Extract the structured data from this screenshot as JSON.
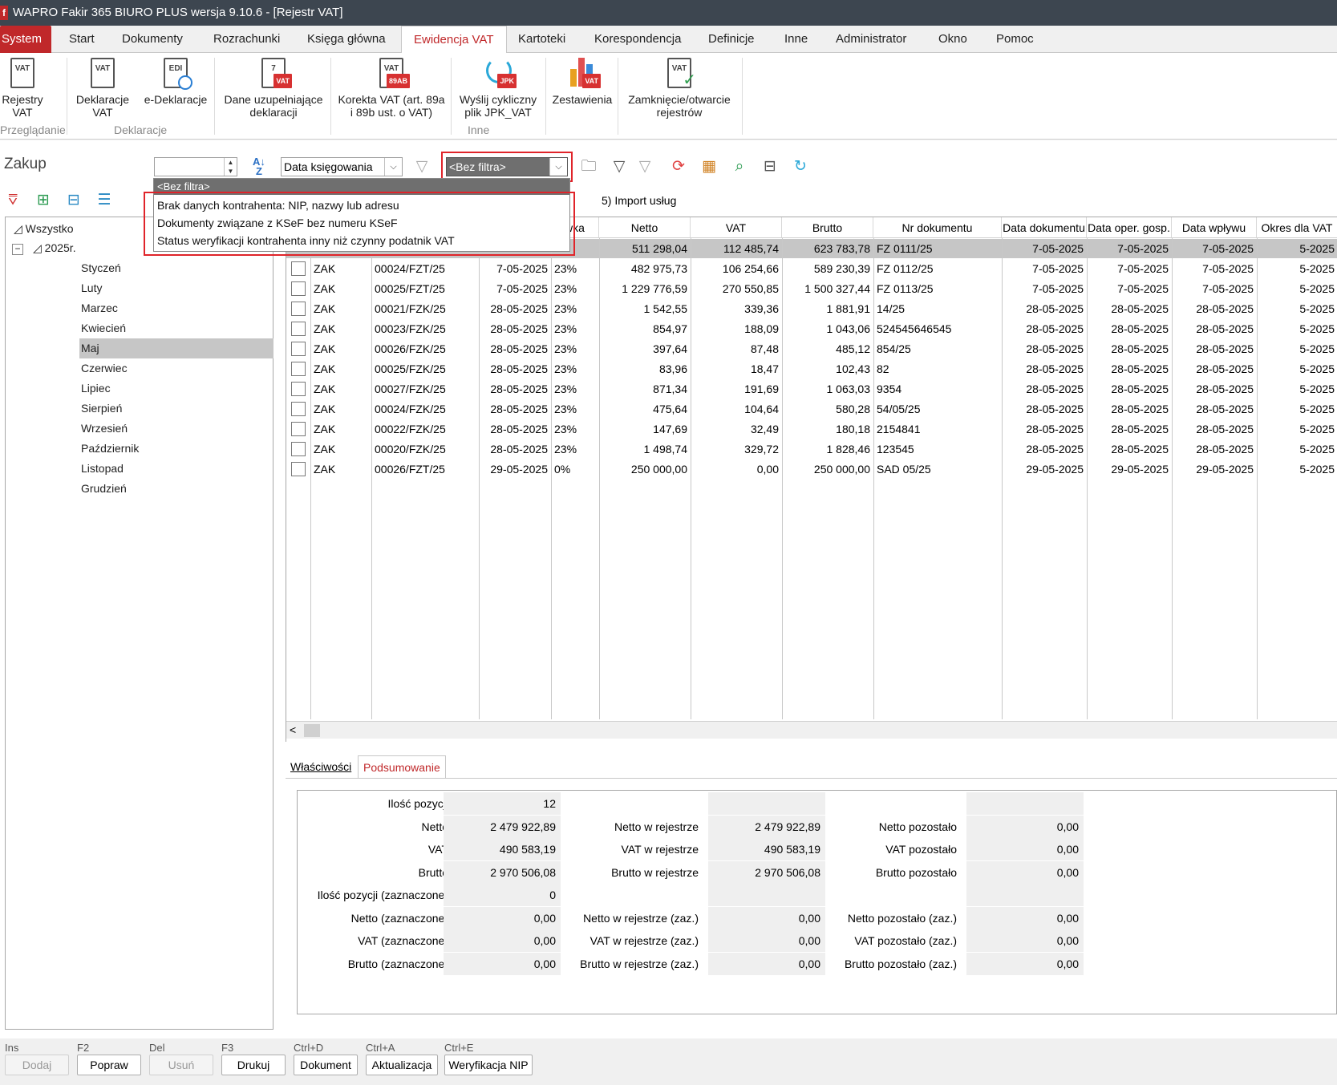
{
  "window": {
    "title": "WAPRO Fakir 365 BIURO PLUS wersja 9.10.6 - [Rejestr VAT]",
    "app_letter": "f"
  },
  "menu": [
    "System",
    "Start",
    "Dokumenty",
    "Rozrachunki",
    "Księga główna",
    "Ewidencja VAT",
    "Kartoteki",
    "Korespondencja",
    "Definicje",
    "Inne",
    "Administrator",
    "Okno",
    "Pomoc"
  ],
  "ribbon": {
    "buttons": [
      {
        "label1": "Rejestry",
        "label2": "VAT",
        "icon": "vat-register-icon",
        "tag": "",
        "doc": "VAT"
      },
      {
        "label1": "Deklaracje",
        "label2": "VAT",
        "icon": "vat-declaration-icon",
        "tag": "",
        "doc": "VAT"
      },
      {
        "label1": "e-Deklaracje",
        "label2": "",
        "icon": "e-declaration-icon",
        "tag": "",
        "doc": "EDI"
      },
      {
        "label1": "Dane uzupełniające",
        "label2": "deklaracji",
        "icon": "supplementary-data-icon",
        "tag": "VAT",
        "doc": "7"
      },
      {
        "label1": "Korekta VAT (art. 89a",
        "label2": "i 89b ust. o VAT)",
        "icon": "vat-correction-icon",
        "tag": "89AB",
        "doc": "VAT"
      },
      {
        "label1": "Wyślij cykliczny",
        "label2": "plik JPK_VAT",
        "icon": "jpk-send-icon",
        "tag": "JPK",
        "doc": ""
      },
      {
        "label1": "Zestawienia",
        "label2": "",
        "icon": "reports-chart-icon",
        "tag": "VAT",
        "doc": ""
      },
      {
        "label1": "Zamknięcie/otwarcie",
        "label2": "rejestrów",
        "icon": "close-registers-icon",
        "tag": "",
        "doc": "VAT"
      }
    ],
    "groups": [
      "Przeglądanie",
      "Deklaracje",
      "Inne"
    ]
  },
  "toolbar": {
    "section_title": "Zakup",
    "sort_field": "Data księgowania",
    "filter_value": "<Bez filtra>",
    "import_label": "5) Import usług"
  },
  "dropdown": {
    "selected": "<Bez filtra>",
    "options": [
      "Brak danych kontrahenta: NIP, nazwy lub adresu",
      "Dokumenty związane z KSeF bez numeru KSeF",
      "Status weryfikacji kontrahenta inny niż czynny podatnik VAT"
    ]
  },
  "tree": {
    "all": "Wszystko",
    "year": "2025r.",
    "months": [
      "Styczeń",
      "Luty",
      "Marzec",
      "Kwiecień",
      "Maj",
      "Czerwiec",
      "Lipiec",
      "Sierpień",
      "Wrzesień",
      "Październik",
      "Listopad",
      "Grudzień"
    ],
    "selected": "Maj"
  },
  "grid": {
    "columns": [
      "",
      "",
      "",
      "",
      "Stawka",
      "Netto",
      "VAT",
      "Brutto",
      "Nr dokumentu",
      "Data dokumentu",
      "Data oper. gosp.",
      "Data wpływu",
      "Okres dla VAT"
    ],
    "visible_header": [
      "wka",
      "Netto",
      "VAT",
      "Brutto",
      "Nr dokumentu",
      "Data dokumentu",
      "Data oper. gosp.",
      "Data wpływu",
      "Okres dla VAT"
    ],
    "rows": [
      {
        "typ": "",
        "nr": "",
        "data": "",
        "stawka": "",
        "netto": "511 298,04",
        "vat": "112 485,74",
        "brutto": "623 783,78",
        "nrdok": "FZ 0111/25",
        "ddok": "7-05-2025",
        "doper": "7-05-2025",
        "dwpl": "7-05-2025",
        "okres": "5-2025"
      },
      {
        "typ": "ZAK",
        "nr": "00024/FZT/25",
        "data": "7-05-2025",
        "stawka": "23%",
        "netto": "482 975,73",
        "vat": "106 254,66",
        "brutto": "589 230,39",
        "nrdok": "FZ 0112/25",
        "ddok": "7-05-2025",
        "doper": "7-05-2025",
        "dwpl": "7-05-2025",
        "okres": "5-2025"
      },
      {
        "typ": "ZAK",
        "nr": "00025/FZT/25",
        "data": "7-05-2025",
        "stawka": "23%",
        "netto": "1 229 776,59",
        "vat": "270 550,85",
        "brutto": "1 500 327,44",
        "nrdok": "FZ 0113/25",
        "ddok": "7-05-2025",
        "doper": "7-05-2025",
        "dwpl": "7-05-2025",
        "okres": "5-2025"
      },
      {
        "typ": "ZAK",
        "nr": "00021/FZK/25",
        "data": "28-05-2025",
        "stawka": "23%",
        "netto": "1 542,55",
        "vat": "339,36",
        "brutto": "1 881,91",
        "nrdok": "14/25",
        "ddok": "28-05-2025",
        "doper": "28-05-2025",
        "dwpl": "28-05-2025",
        "okres": "5-2025"
      },
      {
        "typ": "ZAK",
        "nr": "00023/FZK/25",
        "data": "28-05-2025",
        "stawka": "23%",
        "netto": "854,97",
        "vat": "188,09",
        "brutto": "1 043,06",
        "nrdok": "524545646545",
        "ddok": "28-05-2025",
        "doper": "28-05-2025",
        "dwpl": "28-05-2025",
        "okres": "5-2025"
      },
      {
        "typ": "ZAK",
        "nr": "00026/FZK/25",
        "data": "28-05-2025",
        "stawka": "23%",
        "netto": "397,64",
        "vat": "87,48",
        "brutto": "485,12",
        "nrdok": "854/25",
        "ddok": "28-05-2025",
        "doper": "28-05-2025",
        "dwpl": "28-05-2025",
        "okres": "5-2025"
      },
      {
        "typ": "ZAK",
        "nr": "00025/FZK/25",
        "data": "28-05-2025",
        "stawka": "23%",
        "netto": "83,96",
        "vat": "18,47",
        "brutto": "102,43",
        "nrdok": "82",
        "ddok": "28-05-2025",
        "doper": "28-05-2025",
        "dwpl": "28-05-2025",
        "okres": "5-2025"
      },
      {
        "typ": "ZAK",
        "nr": "00027/FZK/25",
        "data": "28-05-2025",
        "stawka": "23%",
        "netto": "871,34",
        "vat": "191,69",
        "brutto": "1 063,03",
        "nrdok": "9354",
        "ddok": "28-05-2025",
        "doper": "28-05-2025",
        "dwpl": "28-05-2025",
        "okres": "5-2025"
      },
      {
        "typ": "ZAK",
        "nr": "00024/FZK/25",
        "data": "28-05-2025",
        "stawka": "23%",
        "netto": "475,64",
        "vat": "104,64",
        "brutto": "580,28",
        "nrdok": "54/05/25",
        "ddok": "28-05-2025",
        "doper": "28-05-2025",
        "dwpl": "28-05-2025",
        "okres": "5-2025"
      },
      {
        "typ": "ZAK",
        "nr": "00022/FZK/25",
        "data": "28-05-2025",
        "stawka": "23%",
        "netto": "147,69",
        "vat": "32,49",
        "brutto": "180,18",
        "nrdok": "2154841",
        "ddok": "28-05-2025",
        "doper": "28-05-2025",
        "dwpl": "28-05-2025",
        "okres": "5-2025"
      },
      {
        "typ": "ZAK",
        "nr": "00020/FZK/25",
        "data": "28-05-2025",
        "stawka": "23%",
        "netto": "1 498,74",
        "vat": "329,72",
        "brutto": "1 828,46",
        "nrdok": "123545",
        "ddok": "28-05-2025",
        "doper": "28-05-2025",
        "dwpl": "28-05-2025",
        "okres": "5-2025"
      },
      {
        "typ": "ZAK",
        "nr": "00026/FZT/25",
        "data": "29-05-2025",
        "stawka": "0%",
        "netto": "250 000,00",
        "vat": "0,00",
        "brutto": "250 000,00",
        "nrdok": "SAD 05/25",
        "ddok": "29-05-2025",
        "doper": "29-05-2025",
        "dwpl": "29-05-2025",
        "okres": "5-2025"
      }
    ]
  },
  "bottom_tabs": [
    "Właściwości",
    "Podsumowanie"
  ],
  "summary": {
    "col1": [
      {
        "label": "Ilość pozycji",
        "value": "12"
      },
      {
        "label": "Netto",
        "value": "2 479 922,89"
      },
      {
        "label": "VAT",
        "value": "490 583,19"
      },
      {
        "label": "Brutto",
        "value": "2 970 506,08"
      },
      {
        "label": "Ilość pozycji (zaznaczone)",
        "value": "0"
      },
      {
        "label": "Netto (zaznaczone)",
        "value": "0,00"
      },
      {
        "label": "VAT (zaznaczone)",
        "value": "0,00"
      },
      {
        "label": "Brutto (zaznaczone)",
        "value": "0,00"
      }
    ],
    "col2": [
      {
        "label": "",
        "value": ""
      },
      {
        "label": "Netto w rejestrze",
        "value": "2 479 922,89"
      },
      {
        "label": "VAT w rejestrze",
        "value": "490 583,19"
      },
      {
        "label": "Brutto w rejestrze",
        "value": "2 970 506,08"
      },
      {
        "label": "",
        "value": ""
      },
      {
        "label": "Netto w rejestrze (zaz.)",
        "value": "0,00"
      },
      {
        "label": "VAT w rejestrze (zaz.)",
        "value": "0,00"
      },
      {
        "label": "Brutto w rejestrze (zaz.)",
        "value": "0,00"
      }
    ],
    "col3": [
      {
        "label": "",
        "value": ""
      },
      {
        "label": "Netto pozostało",
        "value": "0,00"
      },
      {
        "label": "VAT pozostało",
        "value": "0,00"
      },
      {
        "label": "Brutto pozostało",
        "value": "0,00"
      },
      {
        "label": "",
        "value": ""
      },
      {
        "label": "Netto pozostało (zaz.)",
        "value": "0,00"
      },
      {
        "label": "VAT pozostało (zaz.)",
        "value": "0,00"
      },
      {
        "label": "Brutto pozostało (zaz.)",
        "value": "0,00"
      }
    ]
  },
  "footer": [
    {
      "key": "Ins",
      "label": "Dodaj",
      "enabled": false
    },
    {
      "key": "F2",
      "label": "Popraw",
      "enabled": true
    },
    {
      "key": "Del",
      "label": "Usuń",
      "enabled": false
    },
    {
      "key": "F3",
      "label": "Drukuj",
      "enabled": true
    },
    {
      "key": "Ctrl+D",
      "label": "Dokument",
      "enabled": true
    },
    {
      "key": "Ctrl+A",
      "label": "Aktualizacja",
      "enabled": true
    },
    {
      "key": "Ctrl+E",
      "label": "Weryfikacja NIP",
      "enabled": true
    }
  ]
}
